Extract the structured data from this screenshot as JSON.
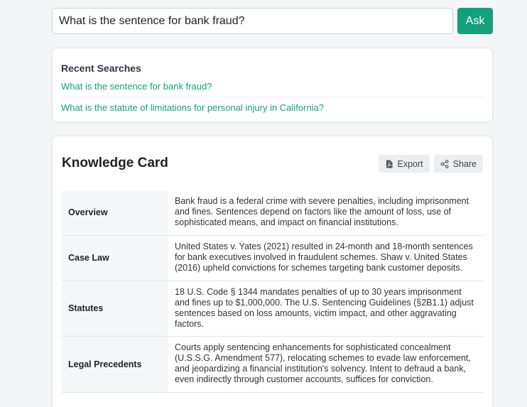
{
  "search": {
    "value": "What is the sentence for bank fraud?",
    "ask_label": "Ask"
  },
  "recent": {
    "title": "Recent Searches",
    "items": [
      "What is the sentence for bank fraud?",
      "What is the statute of limitations for personal injury in California?"
    ]
  },
  "knowledge_card": {
    "title": "Knowledge Card",
    "export_label": "Export",
    "share_label": "Share",
    "rows": [
      {
        "label": "Overview",
        "value": "Bank fraud is a federal crime with severe penalties, including imprisonment and fines. Sentences depend on factors like the amount of loss, use of sophisticated means, and impact on financial institutions."
      },
      {
        "label": "Case Law",
        "value": "United States v. Yates (2021) resulted in 24-month and 18-month sentences for bank executives involved in fraudulent schemes. Shaw v. United States (2016) upheld convictions for schemes targeting bank customer deposits."
      },
      {
        "label": "Statutes",
        "value": "18 U.S. Code § 1344 mandates penalties of up to 30 years imprisonment and fines up to $1,000,000. The U.S. Sentencing Guidelines (§2B1.1) adjust sentences based on loss amounts, victim impact, and other aggravating factors."
      },
      {
        "label": "Legal Precedents",
        "value": "Courts apply sentencing enhancements for sophisticated concealment (U.S.S.G. Amendment 577), relocating schemes to evade law enforcement, and jeopardizing a financial institution's solvency. Intent to defraud a bank, even indirectly through customer accounts, suffices for conviction."
      }
    ]
  },
  "colors": {
    "accent": "#13a17c",
    "background": "#f4f5f7"
  },
  "icons": {
    "export": "pdf-file-icon",
    "share": "share-icon"
  }
}
